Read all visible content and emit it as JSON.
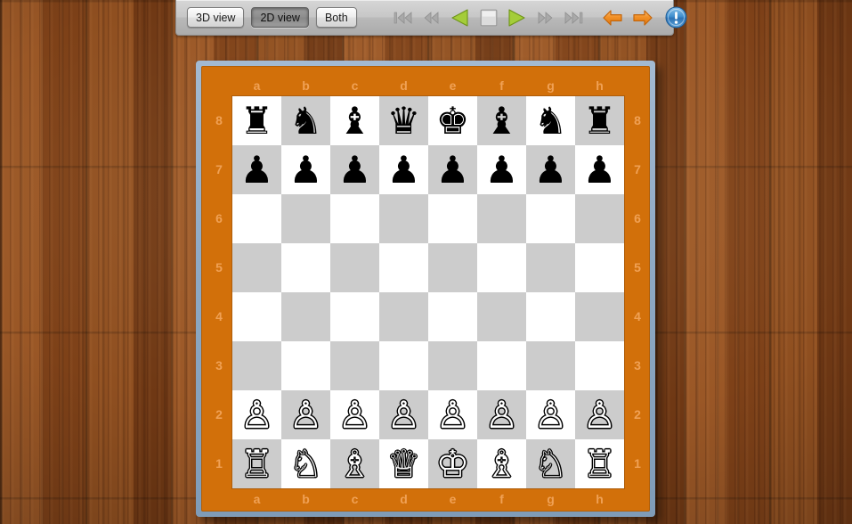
{
  "toolbar": {
    "view_buttons": [
      {
        "label": "3D view",
        "name": "view-3d-button",
        "pressed": false
      },
      {
        "label": "2D view",
        "name": "view-2d-button",
        "pressed": true
      },
      {
        "label": "Both",
        "name": "view-both-button",
        "pressed": false
      }
    ],
    "nav_buttons": [
      {
        "name": "skip-to-start-button",
        "icon": "skip-to-start-icon",
        "state": "disabled"
      },
      {
        "name": "rewind-button",
        "icon": "rewind-icon",
        "state": "disabled"
      },
      {
        "name": "play-backward-button",
        "icon": "play-backward-icon",
        "state": "enabled"
      },
      {
        "name": "stop-button",
        "icon": "stop-icon",
        "state": "enabled"
      },
      {
        "name": "play-forward-button",
        "icon": "play-forward-icon",
        "state": "enabled"
      },
      {
        "name": "fast-forward-button",
        "icon": "fast-forward-icon",
        "state": "disabled"
      },
      {
        "name": "skip-to-end-button",
        "icon": "skip-to-end-icon",
        "state": "disabled"
      }
    ],
    "arrow_buttons": [
      {
        "name": "undo-move-button",
        "icon": "arrow-left-icon",
        "state": "enabled"
      },
      {
        "name": "redo-move-button",
        "icon": "arrow-right-icon",
        "state": "enabled"
      }
    ],
    "info_button": {
      "name": "info-button",
      "icon": "info-circle-icon",
      "glyph": "!"
    }
  },
  "colors": {
    "board_border": "#d2700a",
    "board_frame": "#8ea9c4",
    "light_square": "#ffffff",
    "dark_square": "#cccccc",
    "coord_label": "#f0a155",
    "toolbar_bg": "#c7c7c7",
    "play_green": "#a4cd39",
    "arrow_orange": "#f08a1e",
    "info_blue": "#2f7fc4",
    "wood_background": "#8a4a1f"
  },
  "board": {
    "files": [
      "a",
      "b",
      "c",
      "d",
      "e",
      "f",
      "g",
      "h"
    ],
    "ranks": [
      "8",
      "7",
      "6",
      "5",
      "4",
      "3",
      "2",
      "1"
    ],
    "orientation": "white-bottom",
    "position_name": "starting-position",
    "squares": [
      [
        {
          "square": "a8",
          "piece": "♜",
          "color": "black",
          "type": "rook",
          "shade": "light"
        },
        {
          "square": "b8",
          "piece": "♞",
          "color": "black",
          "type": "knight",
          "shade": "dark"
        },
        {
          "square": "c8",
          "piece": "♝",
          "color": "black",
          "type": "bishop",
          "shade": "light"
        },
        {
          "square": "d8",
          "piece": "♛",
          "color": "black",
          "type": "queen",
          "shade": "dark"
        },
        {
          "square": "e8",
          "piece": "♚",
          "color": "black",
          "type": "king",
          "shade": "light"
        },
        {
          "square": "f8",
          "piece": "♝",
          "color": "black",
          "type": "bishop",
          "shade": "dark"
        },
        {
          "square": "g8",
          "piece": "♞",
          "color": "black",
          "type": "knight",
          "shade": "light"
        },
        {
          "square": "h8",
          "piece": "♜",
          "color": "black",
          "type": "rook",
          "shade": "dark"
        }
      ],
      [
        {
          "square": "a7",
          "piece": "♟",
          "color": "black",
          "type": "pawn",
          "shade": "dark"
        },
        {
          "square": "b7",
          "piece": "♟",
          "color": "black",
          "type": "pawn",
          "shade": "light"
        },
        {
          "square": "c7",
          "piece": "♟",
          "color": "black",
          "type": "pawn",
          "shade": "dark"
        },
        {
          "square": "d7",
          "piece": "♟",
          "color": "black",
          "type": "pawn",
          "shade": "light"
        },
        {
          "square": "e7",
          "piece": "♟",
          "color": "black",
          "type": "pawn",
          "shade": "dark"
        },
        {
          "square": "f7",
          "piece": "♟",
          "color": "black",
          "type": "pawn",
          "shade": "light"
        },
        {
          "square": "g7",
          "piece": "♟",
          "color": "black",
          "type": "pawn",
          "shade": "dark"
        },
        {
          "square": "h7",
          "piece": "♟",
          "color": "black",
          "type": "pawn",
          "shade": "light"
        }
      ],
      [
        {
          "square": "a6",
          "piece": "",
          "color": "",
          "type": "",
          "shade": "light"
        },
        {
          "square": "b6",
          "piece": "",
          "color": "",
          "type": "",
          "shade": "dark"
        },
        {
          "square": "c6",
          "piece": "",
          "color": "",
          "type": "",
          "shade": "light"
        },
        {
          "square": "d6",
          "piece": "",
          "color": "",
          "type": "",
          "shade": "dark"
        },
        {
          "square": "e6",
          "piece": "",
          "color": "",
          "type": "",
          "shade": "light"
        },
        {
          "square": "f6",
          "piece": "",
          "color": "",
          "type": "",
          "shade": "dark"
        },
        {
          "square": "g6",
          "piece": "",
          "color": "",
          "type": "",
          "shade": "light"
        },
        {
          "square": "h6",
          "piece": "",
          "color": "",
          "type": "",
          "shade": "dark"
        }
      ],
      [
        {
          "square": "a5",
          "piece": "",
          "color": "",
          "type": "",
          "shade": "dark"
        },
        {
          "square": "b5",
          "piece": "",
          "color": "",
          "type": "",
          "shade": "light"
        },
        {
          "square": "c5",
          "piece": "",
          "color": "",
          "type": "",
          "shade": "dark"
        },
        {
          "square": "d5",
          "piece": "",
          "color": "",
          "type": "",
          "shade": "light"
        },
        {
          "square": "e5",
          "piece": "",
          "color": "",
          "type": "",
          "shade": "dark"
        },
        {
          "square": "f5",
          "piece": "",
          "color": "",
          "type": "",
          "shade": "light"
        },
        {
          "square": "g5",
          "piece": "",
          "color": "",
          "type": "",
          "shade": "dark"
        },
        {
          "square": "h5",
          "piece": "",
          "color": "",
          "type": "",
          "shade": "light"
        }
      ],
      [
        {
          "square": "a4",
          "piece": "",
          "color": "",
          "type": "",
          "shade": "light"
        },
        {
          "square": "b4",
          "piece": "",
          "color": "",
          "type": "",
          "shade": "dark"
        },
        {
          "square": "c4",
          "piece": "",
          "color": "",
          "type": "",
          "shade": "light"
        },
        {
          "square": "d4",
          "piece": "",
          "color": "",
          "type": "",
          "shade": "dark"
        },
        {
          "square": "e4",
          "piece": "",
          "color": "",
          "type": "",
          "shade": "light"
        },
        {
          "square": "f4",
          "piece": "",
          "color": "",
          "type": "",
          "shade": "dark"
        },
        {
          "square": "g4",
          "piece": "",
          "color": "",
          "type": "",
          "shade": "light"
        },
        {
          "square": "h4",
          "piece": "",
          "color": "",
          "type": "",
          "shade": "dark"
        }
      ],
      [
        {
          "square": "a3",
          "piece": "",
          "color": "",
          "type": "",
          "shade": "dark"
        },
        {
          "square": "b3",
          "piece": "",
          "color": "",
          "type": "",
          "shade": "light"
        },
        {
          "square": "c3",
          "piece": "",
          "color": "",
          "type": "",
          "shade": "dark"
        },
        {
          "square": "d3",
          "piece": "",
          "color": "",
          "type": "",
          "shade": "light"
        },
        {
          "square": "e3",
          "piece": "",
          "color": "",
          "type": "",
          "shade": "dark"
        },
        {
          "square": "f3",
          "piece": "",
          "color": "",
          "type": "",
          "shade": "light"
        },
        {
          "square": "g3",
          "piece": "",
          "color": "",
          "type": "",
          "shade": "dark"
        },
        {
          "square": "h3",
          "piece": "",
          "color": "",
          "type": "",
          "shade": "light"
        }
      ],
      [
        {
          "square": "a2",
          "piece": "♙",
          "color": "white",
          "type": "pawn",
          "shade": "light"
        },
        {
          "square": "b2",
          "piece": "♙",
          "color": "white",
          "type": "pawn",
          "shade": "dark"
        },
        {
          "square": "c2",
          "piece": "♙",
          "color": "white",
          "type": "pawn",
          "shade": "light"
        },
        {
          "square": "d2",
          "piece": "♙",
          "color": "white",
          "type": "pawn",
          "shade": "dark"
        },
        {
          "square": "e2",
          "piece": "♙",
          "color": "white",
          "type": "pawn",
          "shade": "light"
        },
        {
          "square": "f2",
          "piece": "♙",
          "color": "white",
          "type": "pawn",
          "shade": "dark"
        },
        {
          "square": "g2",
          "piece": "♙",
          "color": "white",
          "type": "pawn",
          "shade": "light"
        },
        {
          "square": "h2",
          "piece": "♙",
          "color": "white",
          "type": "pawn",
          "shade": "dark"
        }
      ],
      [
        {
          "square": "a1",
          "piece": "♖",
          "color": "white",
          "type": "rook",
          "shade": "dark"
        },
        {
          "square": "b1",
          "piece": "♘",
          "color": "white",
          "type": "knight",
          "shade": "light"
        },
        {
          "square": "c1",
          "piece": "♗",
          "color": "white",
          "type": "bishop",
          "shade": "dark"
        },
        {
          "square": "d1",
          "piece": "♕",
          "color": "white",
          "type": "queen",
          "shade": "light"
        },
        {
          "square": "e1",
          "piece": "♔",
          "color": "white",
          "type": "king",
          "shade": "dark"
        },
        {
          "square": "f1",
          "piece": "♗",
          "color": "white",
          "type": "bishop",
          "shade": "light"
        },
        {
          "square": "g1",
          "piece": "♘",
          "color": "white",
          "type": "knight",
          "shade": "dark"
        },
        {
          "square": "h1",
          "piece": "♖",
          "color": "white",
          "type": "rook",
          "shade": "light"
        }
      ]
    ]
  }
}
